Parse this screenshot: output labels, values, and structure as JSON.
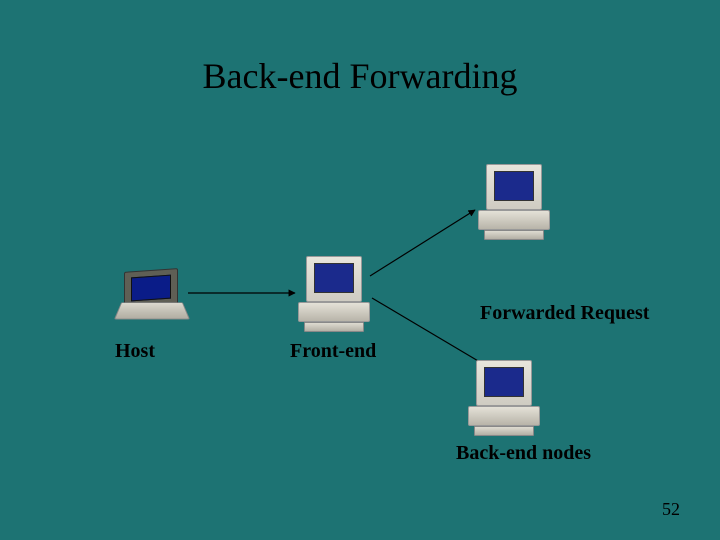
{
  "title": "Back-end Forwarding",
  "labels": {
    "host": "Host",
    "frontend": "Front-end",
    "forwarded": "Forwarded Request",
    "backend": "Back-end nodes"
  },
  "page_number": "52"
}
